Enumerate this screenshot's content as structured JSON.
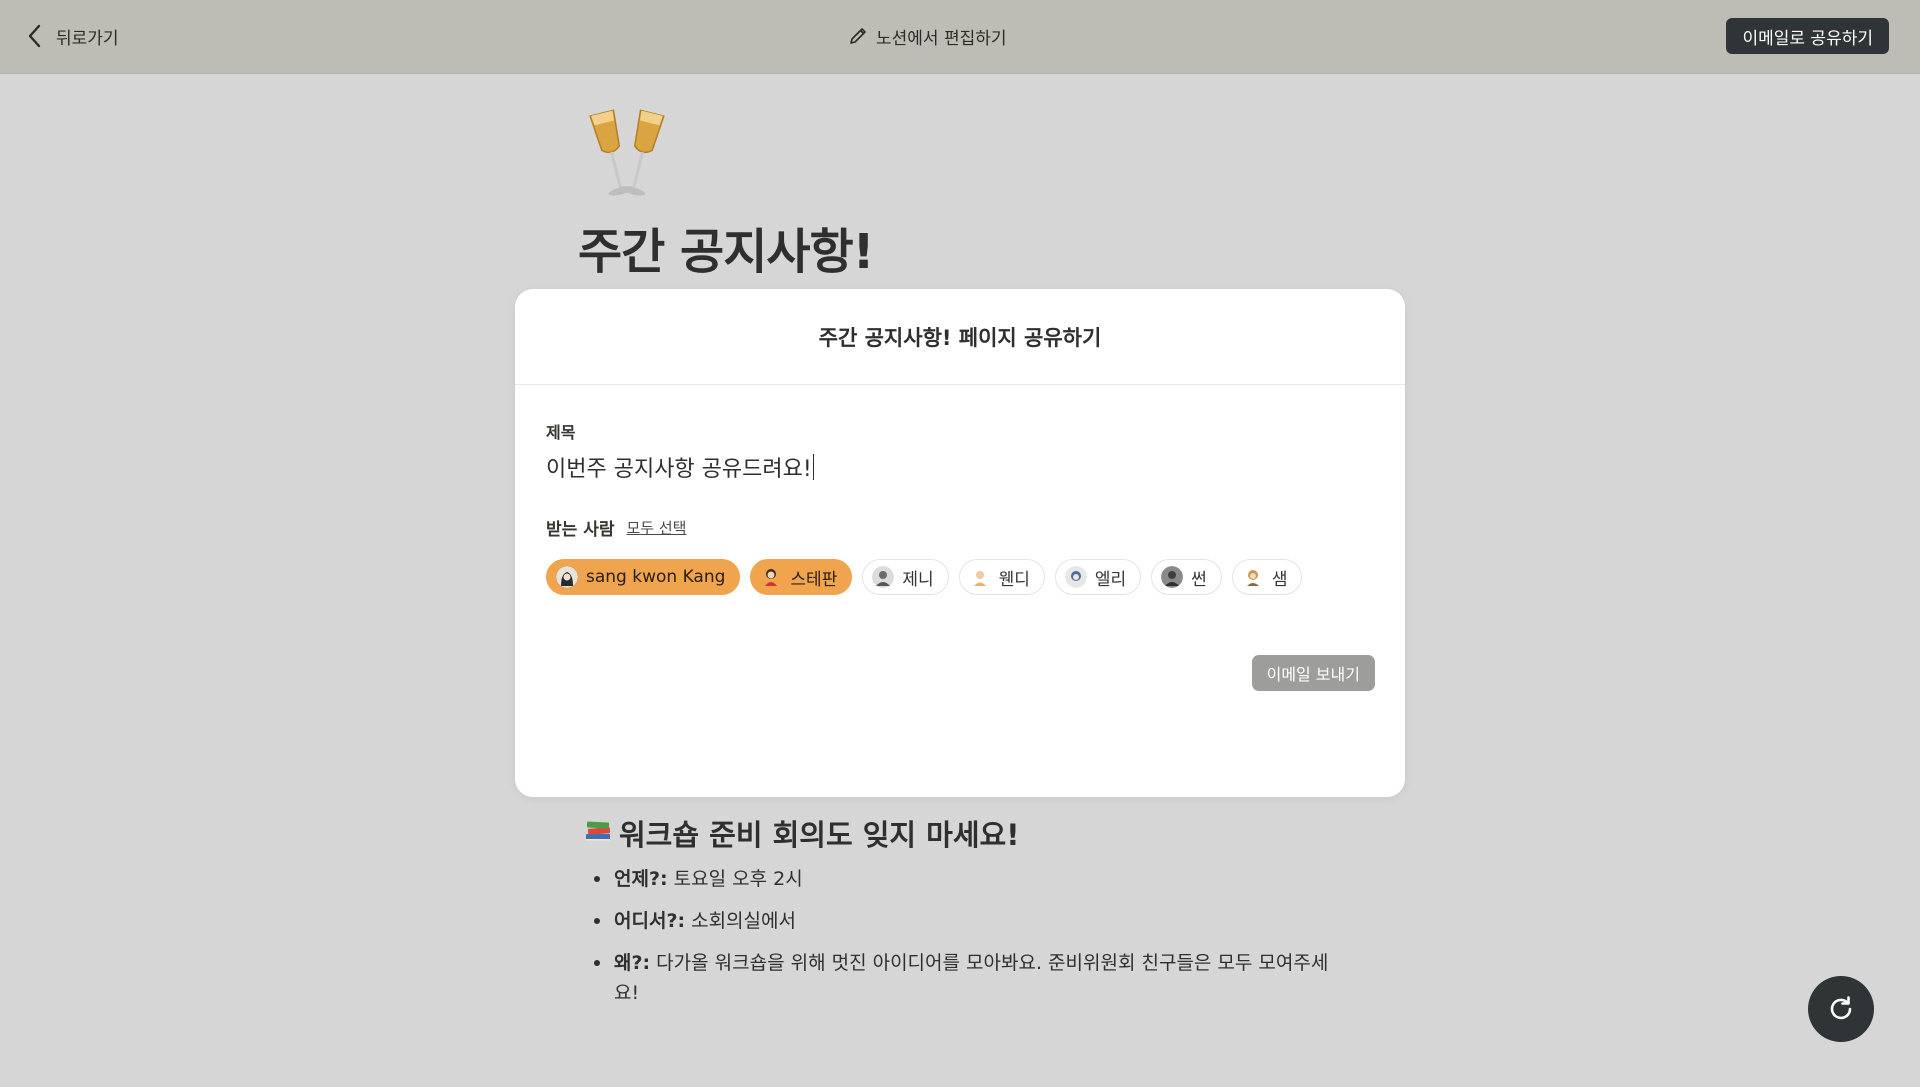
{
  "topbar": {
    "back_label": "뒤로가기",
    "edit_label": "노션에서 편집하기",
    "share_email_label": "이메일로 공유하기"
  },
  "page": {
    "emoji": "🥂",
    "title": "주간 공지사항!"
  },
  "modal": {
    "title": "주간 공지사항! 페이지 공유하기",
    "subject_label": "제목",
    "subject_value": "이번주 공지사항 공유드려요!",
    "recipients_label": "받는 사람",
    "select_all_label": "모두 선택",
    "recipients": [
      {
        "name": "sang kwon Kang",
        "selected": true,
        "avatar_icon": "person-avatar"
      },
      {
        "name": "스테판",
        "selected": true,
        "avatar_icon": "person-avatar"
      },
      {
        "name": "제니",
        "selected": false,
        "avatar_icon": "person-avatar"
      },
      {
        "name": "웬디",
        "selected": false,
        "avatar_icon": "person-avatar"
      },
      {
        "name": "엘리",
        "selected": false,
        "avatar_icon": "person-avatar"
      },
      {
        "name": "썬",
        "selected": false,
        "avatar_icon": "person-avatar"
      },
      {
        "name": "샘",
        "selected": false,
        "avatar_icon": "person-avatar"
      }
    ],
    "send_label": "이메일 보내기"
  },
  "content": {
    "section_emoji": "📚",
    "section_heading": "워크숍 준비 회의도 잊지 마세요!",
    "bullets": [
      {
        "label": "언제?:",
        "text": " 토요일 오후 2시"
      },
      {
        "label": "어디서?:",
        "text": " 소회의실에서"
      },
      {
        "label": "왜?:",
        "text": " 다가올 워크숍을 위해 멋진 아이디어를 모아봐요. 준비위원회 친구들은 모두 모여주세요!"
      }
    ]
  },
  "colors": {
    "topbar_bg": "#bdbdb5",
    "page_bg": "#d6d6d6",
    "chip_selected": "#f0a44e",
    "dark_button": "#2f3437",
    "disabled_button": "#9d9d9b"
  }
}
